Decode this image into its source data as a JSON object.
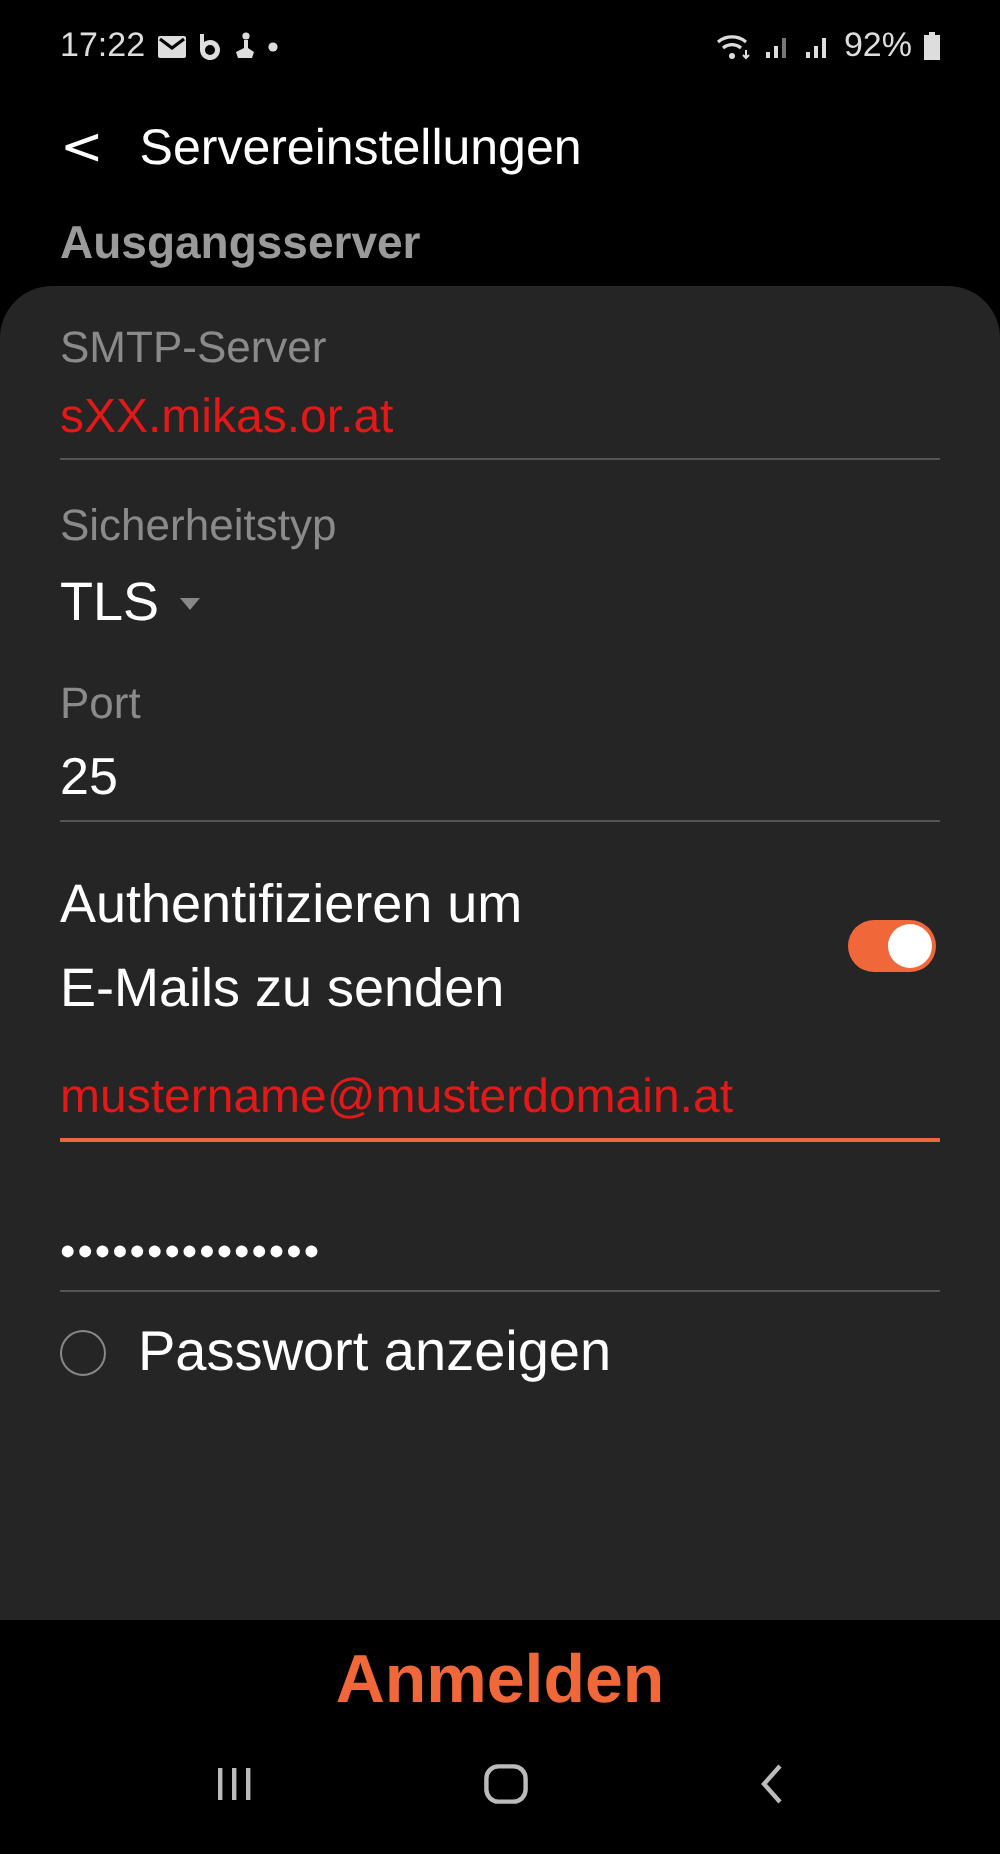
{
  "status_bar": {
    "time": "17:22",
    "battery": "92%"
  },
  "header": {
    "back": "<",
    "title": "Servereinstellungen"
  },
  "section_title": "Ausgangsserver",
  "fields": [
    {
      "kind": "text",
      "label": "SMTP-Server",
      "value": "sXX.mikas.or.at",
      "focused": false
    },
    {
      "kind": "dropdown",
      "label": "Sicherheitstyp",
      "value": "TLS"
    },
    {
      "kind": "text",
      "label": "Port",
      "value": "25",
      "focused": false
    },
    {
      "kind": "switch",
      "label": "Authentifizieren um E-Mails zu senden",
      "on": true
    },
    {
      "kind": "text",
      "value": "mustername@musterdomain.at",
      "focused": true
    },
    {
      "kind": "password",
      "value": "•••••••••••••••",
      "focused": false
    },
    {
      "kind": "checkbox",
      "label": "Passwort anzeigen",
      "checked": false
    }
  ],
  "sign_in_button": "Anmelden"
}
